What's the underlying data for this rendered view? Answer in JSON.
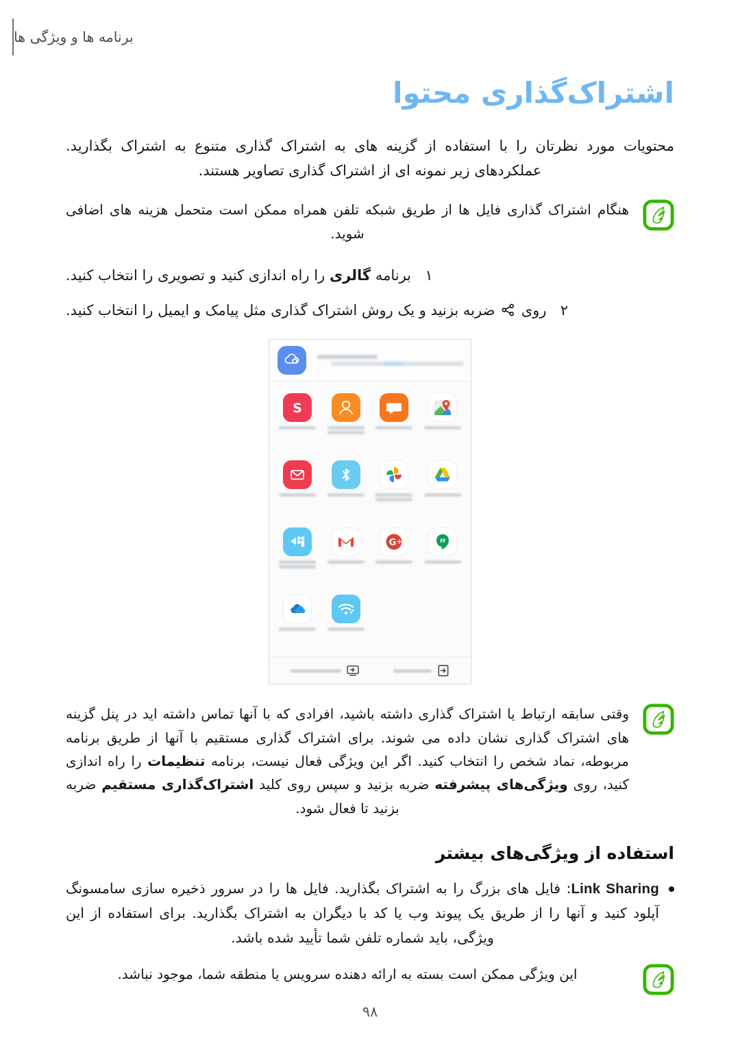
{
  "header": {
    "running_title": "برنامه ها و ویژگی ها"
  },
  "title": "اشتراک‌گذاری محتوا",
  "intro": "محتویات مورد نظرتان را با استفاده از گزینه های به اشتراک گذاری متنوع به اشتراک بگذارید. عملکردهای زیر نمونه ای از اشتراک گذاری تصاویر هستند.",
  "note_top": {
    "icon": "note-leaf-icon",
    "text": "هنگام اشتراک گذاری فایل ها از طریق شبکه تلفن همراه ممکن است متحمل هزینه های اضافی شوید."
  },
  "steps": [
    {
      "number": "۱",
      "text_before": "برنامه ",
      "bold": "گالری",
      "text_after": " را راه اندازی کنید و تصویری را انتخاب کنید."
    },
    {
      "number": "۲",
      "text_before": "روی ",
      "icon": "share-icon",
      "text_after": " ضربه بزنید و یک روش اشتراک گذاری مثل پیامک و ایمیل را انتخاب کنید."
    }
  ],
  "figure": {
    "name": "share-sheet-screenshot",
    "header_app": {
      "name": "samsung-cloud-icon",
      "color": "#5b8def"
    },
    "apps_row1": [
      {
        "name": "maps-icon",
        "color": "#ffffff"
      },
      {
        "name": "messages-icon",
        "color": "#f7751f"
      },
      {
        "name": "contacts-icon",
        "color": "#fa8c24"
      },
      {
        "name": "skype-icon",
        "color": "#ef3b55"
      }
    ],
    "apps_row2": [
      {
        "name": "google-drive-icon",
        "color": "#ffffff"
      },
      {
        "name": "google-photos-icon",
        "color": "#ffffff"
      },
      {
        "name": "bluetooth-icon",
        "color": "#68cdf0"
      },
      {
        "name": "email-icon",
        "color": "#ef3b4e"
      }
    ],
    "apps_row3": [
      {
        "name": "hangouts-icon",
        "color": "#ffffff"
      },
      {
        "name": "google-plus-icon",
        "color": "#ffffff"
      },
      {
        "name": "gmail-icon",
        "color": "#ffffff"
      },
      {
        "name": "smart-switch-icon",
        "color": "#5ec8f2"
      }
    ],
    "apps_row4": [
      {
        "name": "empty-slot",
        "color": "transparent"
      },
      {
        "name": "empty-slot",
        "color": "transparent"
      },
      {
        "name": "wifi-direct-icon",
        "color": "#5ec8f2"
      },
      {
        "name": "onedrive-icon",
        "color": "#ffffff"
      }
    ],
    "footer_items": [
      {
        "name": "screen-mirroring-icon"
      },
      {
        "name": "link-sharing-icon"
      }
    ]
  },
  "note_bottom": {
    "icon": "note-leaf-icon",
    "line1": "وقتی سابقه ارتباط یا اشتراک گذاری داشته باشید، افرادی که با آنها تماس داشته اید در پنل گزینه های اشتراک گذاری نشان داده می شوند. برای اشتراک گذاری مستقیم با آنها از طریق برنامه مربوطه، نماد شخص را انتخاب کنید. اگر این ویژگی فعال نیست، برنامه ",
    "bold1": "تنظیمات",
    "line2": " را راه اندازی کنید، روی ",
    "bold2": "ویژگی‌های پیشرفته",
    "line3": " ضربه بزنید و سپس روی کلید ",
    "bold3": "اشتراک‌گذاری مستقیم",
    "line4": " ضربه بزنید تا فعال شود."
  },
  "subheading": "استفاده از ویژگی‌های بیشتر",
  "bullet": {
    "term": "Link Sharing",
    "text": ": فایل های بزرگ را به اشتراک بگذارید. فایل ها را در سرور ذخیره سازی سامسونگ آپلود کنید و آنها را از طریق یک پیوند وب یا کد با دیگران به اشتراک بگذارید. برای استفاده از این ویژگی، باید شماره تلفن شما تأیید شده باشد."
  },
  "note_last": {
    "icon": "note-leaf-icon",
    "text": "این ویژگی ممکن است بسته به ارائه دهنده سرویس یا منطقه شما، موجود نباشد."
  },
  "folio": "۹۸",
  "colors": {
    "title_blue": "#6fb7f2",
    "note_green": "#36b500",
    "header_gray": "#4c4c4c",
    "body_black": "#171717"
  }
}
